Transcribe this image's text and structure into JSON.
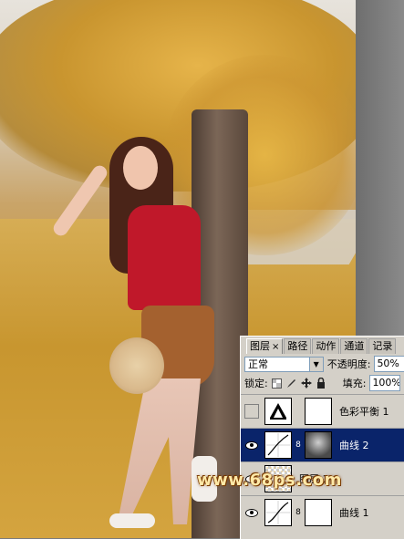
{
  "watermark": {
    "text": "www.68ps.com"
  },
  "panel": {
    "tabs": [
      {
        "label": "图层",
        "close": "×"
      },
      {
        "label": "路径"
      },
      {
        "label": "动作"
      },
      {
        "label": "通道"
      },
      {
        "label": "记录"
      }
    ],
    "blend_mode": "正常",
    "opacity_label": "不透明度:",
    "opacity_value": "50%",
    "lock_label": "锁定:",
    "fill_label": "填充:",
    "fill_value": "100%",
    "lock_icons": [
      "lock-transparent-icon",
      "lock-brush-icon",
      "lock-move-icon",
      "lock-all-icon"
    ],
    "layers": [
      {
        "name": "色彩平衡 1",
        "visible": false,
        "selected": false,
        "thumb": "color-balance-icon"
      },
      {
        "name": "曲线 2",
        "visible": true,
        "selected": true,
        "thumb": "curves-icon"
      },
      {
        "name": "图层 1",
        "visible": true,
        "selected": false,
        "thumb": "layer-pixel-thumbnail"
      },
      {
        "name": "曲线 1",
        "visible": true,
        "selected": false,
        "thumb": "curves-icon"
      }
    ]
  },
  "colors": {
    "selected_layer": "#0a246a",
    "panel_bg": "#d4d0c8",
    "watermark": "#ffe9a8"
  }
}
